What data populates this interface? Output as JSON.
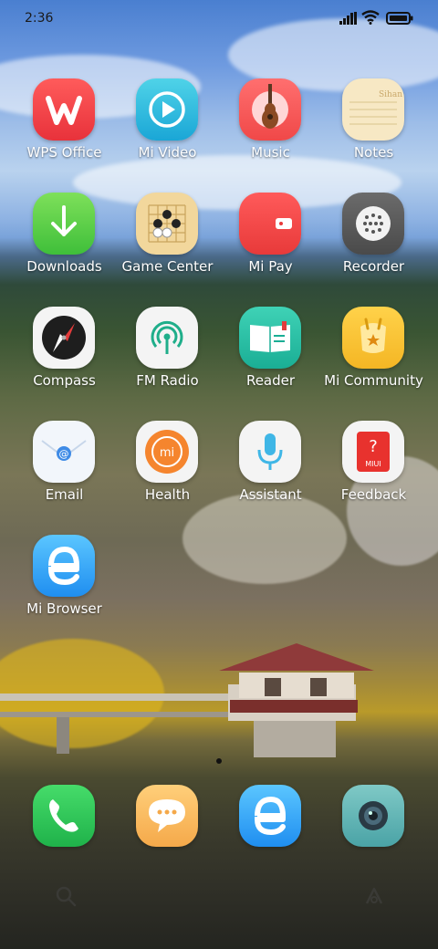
{
  "status_bar": {
    "time": "2:36"
  },
  "apps": [
    {
      "label": "WPS Office",
      "icon": "wps-office-icon"
    },
    {
      "label": "Mi Video",
      "icon": "play-icon"
    },
    {
      "label": "Music",
      "icon": "guitar-icon"
    },
    {
      "label": "Notes",
      "icon": "notes-icon",
      "icon_text": "Sihan"
    },
    {
      "label": "Downloads",
      "icon": "download-arrow-icon"
    },
    {
      "label": "Game Center",
      "icon": "go-board-icon"
    },
    {
      "label": "Mi Pay",
      "icon": "wallet-icon"
    },
    {
      "label": "Recorder",
      "icon": "recorder-icon"
    },
    {
      "label": "Compass",
      "icon": "compass-icon"
    },
    {
      "label": "FM Radio",
      "icon": "radio-signal-icon"
    },
    {
      "label": "Reader",
      "icon": "book-icon"
    },
    {
      "label": "Mi Community",
      "icon": "mi-bunny-icon"
    },
    {
      "label": "Email",
      "icon": "envelope-icon"
    },
    {
      "label": "Health",
      "icon": "health-mi-icon",
      "icon_text": "mi"
    },
    {
      "label": "Assistant",
      "icon": "microphone-icon"
    },
    {
      "label": "Feedback",
      "icon": "feedback-bag-icon",
      "icon_text": "MIUI"
    },
    {
      "label": "Mi Browser",
      "icon": "browser-e-icon"
    }
  ],
  "dock": [
    {
      "icon": "phone-icon"
    },
    {
      "icon": "messages-icon"
    },
    {
      "icon": "browser-e-icon"
    },
    {
      "icon": "camera-icon"
    }
  ],
  "colors": {
    "label_text": "#ffffff",
    "status_text": "#1a1a1a"
  }
}
